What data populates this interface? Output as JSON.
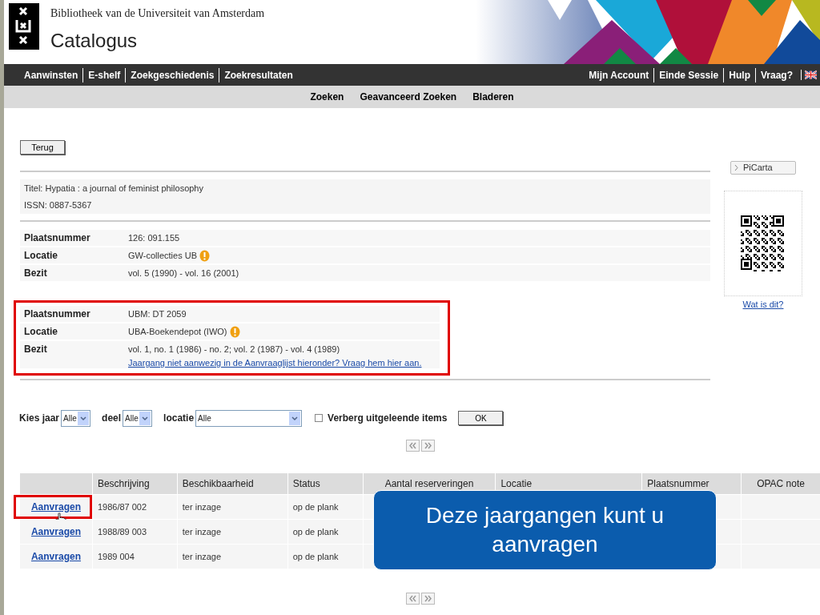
{
  "header": {
    "institution": "Bibliotheek van de Universiteit van Amsterdam",
    "title": "Catalogus"
  },
  "nav_left": [
    "Aanwinsten",
    "E-shelf",
    "Zoekgeschiedenis",
    "Zoekresultaten"
  ],
  "nav_right": [
    "Mijn Account",
    "Einde Sessie",
    "Hulp",
    "Vraag?"
  ],
  "subnav": [
    "Zoeken",
    "Geavanceerd Zoeken",
    "Bladeren"
  ],
  "back_button": "Terug",
  "record": {
    "title": "Titel: Hypatia : a journal of feminist philosophy",
    "issn": "ISSN: 0887-5367"
  },
  "holdings": [
    {
      "highlighted": false,
      "fields": [
        {
          "label": "Plaatsnummer",
          "value": "126: 091.155",
          "info": false
        },
        {
          "label": "Locatie",
          "value": "GW-collecties UB",
          "info": true
        },
        {
          "label": "Bezit",
          "value": "vol. 5 (1990) - vol. 16 (2001)",
          "info": false
        }
      ]
    },
    {
      "highlighted": true,
      "fields": [
        {
          "label": "Plaatsnummer",
          "value": "UBM: DT 2059",
          "info": false
        },
        {
          "label": "Locatie",
          "value": "UBA-Boekendepot (IWO)",
          "info": true
        },
        {
          "label": "Bezit",
          "value": "vol. 1, no. 1 (1986) - no. 2;  vol. 2 (1987) - vol. 4 (1989)",
          "info": false,
          "link": "Jaargang niet aanwezig in de Aanvraaglijst hieronder? Vraag hem hier aan."
        }
      ]
    }
  ],
  "sidebar": {
    "picarta_button": "PiCarta",
    "qr_link": "Wat is dit?"
  },
  "filters": {
    "year": {
      "label": "Kies jaar",
      "value": "Alle"
    },
    "part": {
      "label": "deel",
      "value": "Alle"
    },
    "location": {
      "label": "locatie",
      "value": "Alle"
    },
    "hide_checkbox": {
      "label": "Verberg uitgeleende items",
      "checked": false
    },
    "ok_button": "OK"
  },
  "table": {
    "columns": [
      "",
      "Beschrijving",
      "Beschikbaarheid",
      "Status",
      "Aantal reserveringen",
      "Locatie",
      "Plaatsnummer",
      "OPAC note"
    ],
    "rows": [
      {
        "highlighted": true,
        "cells": [
          "Aanvragen",
          "1986/87 002",
          "ter inzage",
          "op de plank"
        ]
      },
      {
        "highlighted": false,
        "cells": [
          "Aanvragen",
          "1988/89 003",
          "ter inzage",
          "op de plank"
        ]
      },
      {
        "highlighted": false,
        "cells": [
          "Aanvragen",
          "1989 004",
          "ter inzage",
          "op de plank"
        ]
      }
    ]
  },
  "callout": "Deze jaargangen kunt u aanvragen"
}
